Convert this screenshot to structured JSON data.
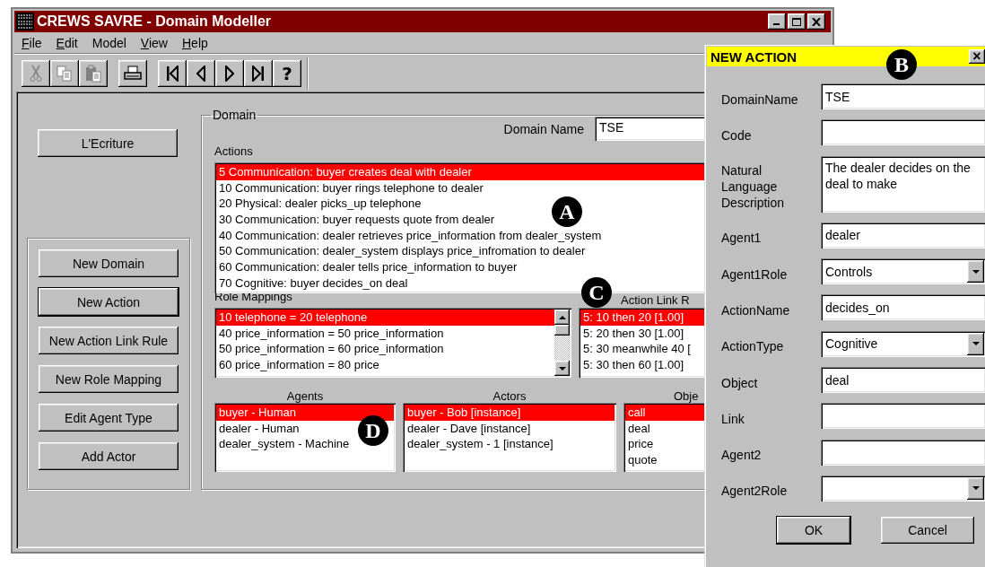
{
  "window": {
    "title": "CREWS SAVRE - Domain Modeller"
  },
  "menu": [
    {
      "label": "File",
      "access_key": true
    },
    {
      "label": "Edit",
      "access_key": true
    },
    {
      "label": "Model",
      "access_key": false
    },
    {
      "label": "View",
      "access_key": true
    },
    {
      "label": "Help",
      "access_key": true
    }
  ],
  "toolbar": [
    [
      {
        "kind": "cut",
        "disabled": true
      },
      {
        "kind": "copy",
        "disabled": true
      },
      {
        "kind": "paste",
        "disabled": true
      }
    ],
    [
      {
        "kind": "print",
        "disabled": false
      }
    ],
    [
      {
        "kind": "first",
        "disabled": false
      },
      {
        "kind": "prev",
        "disabled": false
      },
      {
        "kind": "next",
        "disabled": false
      },
      {
        "kind": "last",
        "disabled": false
      },
      {
        "kind": "help",
        "disabled": false,
        "glyph": "?"
      }
    ]
  ],
  "top_button": {
    "label": "L'Ecriture",
    "default": false
  },
  "side_buttons": [
    {
      "label": "New Domain",
      "default": false
    },
    {
      "label": "New Action",
      "default": true
    },
    {
      "label": "New Action Link Rule",
      "default": false
    },
    {
      "label": "New Role Mapping",
      "default": false
    },
    {
      "label": "Edit Agent Type",
      "default": false
    },
    {
      "label": "Add Actor",
      "default": false
    }
  ],
  "domain": {
    "legend": "Domain",
    "name_label": "Domain Name",
    "name_value": "TSE",
    "actions": {
      "label": "Actions",
      "items": [
        {
          "text": "5 Communication: buyer creates deal with dealer",
          "selected": true
        },
        {
          "text": "10 Communication: buyer rings telephone to dealer",
          "selected": false
        },
        {
          "text": "20 Physical: dealer picks_up telephone",
          "selected": false
        },
        {
          "text": "30 Communication: buyer requests quote from dealer",
          "selected": false
        },
        {
          "text": "40 Communication: dealer retrieves price_information from dealer_system",
          "selected": false
        },
        {
          "text": "50 Communication: dealer_system displays price_infromation to dealer",
          "selected": false
        },
        {
          "text": "60 Communication: dealer tells price_information to buyer",
          "selected": false
        },
        {
          "text": "70 Cognitive: buyer decides_on deal",
          "selected": false
        }
      ]
    },
    "role_mappings": {
      "label": "Role Mappings",
      "items": [
        {
          "text": "10 telephone = 20 telephone",
          "selected": true
        },
        {
          "text": "40 price_information = 50 price_information",
          "selected": false
        },
        {
          "text": "50 price_information = 60 price_information",
          "selected": false
        },
        {
          "text": "60 price_information = 80 price",
          "selected": false
        }
      ]
    },
    "action_links": {
      "label": "Action Link R",
      "items": [
        {
          "text": "5: 10 then 20 [1.00]",
          "selected": true
        },
        {
          "text": "5: 20 then 30 [1.00]",
          "selected": false
        },
        {
          "text": "5: 30 meanwhile 40 [",
          "selected": false
        },
        {
          "text": "5: 30 then 60 [1.00]",
          "selected": false
        }
      ]
    },
    "agents": {
      "label": "Agents",
      "items": [
        {
          "text": "buyer - Human",
          "selected": true
        },
        {
          "text": "dealer - Human",
          "selected": false
        },
        {
          "text": "dealer_system - Machine",
          "selected": false
        }
      ]
    },
    "actors": {
      "label": "Actors",
      "items": [
        {
          "text": "buyer - Bob [instance]",
          "selected": true
        },
        {
          "text": "dealer - Dave [instance]",
          "selected": false
        },
        {
          "text": "dealer_system - 1 [instance]",
          "selected": false
        }
      ]
    },
    "objects": {
      "label": "Obje",
      "items": [
        {
          "text": "call",
          "selected": true
        },
        {
          "text": "deal",
          "selected": false
        },
        {
          "text": "price",
          "selected": false
        },
        {
          "text": "quote",
          "selected": false
        }
      ]
    }
  },
  "dialog": {
    "title": "NEW ACTION",
    "close": "×",
    "fields": [
      {
        "label": "DomainName",
        "kind": "text",
        "value": "TSE"
      },
      {
        "label": "Code",
        "kind": "text"
      },
      {
        "label": "Natural Language Description",
        "kind": "textarea",
        "value": "The dealer decides on the deal to make"
      },
      {
        "label": "Agent1",
        "kind": "text",
        "value": "dealer"
      },
      {
        "label": "Agent1Role",
        "kind": "select",
        "value": "Controls"
      },
      {
        "label": "ActionName",
        "kind": "text",
        "value": "decides_on"
      },
      {
        "label": "ActionType",
        "kind": "select",
        "value": "Cognitive"
      },
      {
        "label": "Object",
        "kind": "text",
        "value": "deal"
      },
      {
        "label": "Link",
        "kind": "text"
      },
      {
        "label": "Agent2",
        "kind": "text"
      },
      {
        "label": "Agent2Role",
        "kind": "select"
      }
    ],
    "buttons": [
      {
        "label": "OK",
        "default": true
      },
      {
        "label": "Cancel",
        "default": false
      }
    ]
  },
  "annotations": [
    {
      "letter": "A"
    },
    {
      "letter": "B"
    },
    {
      "letter": "C"
    },
    {
      "letter": "D"
    }
  ]
}
